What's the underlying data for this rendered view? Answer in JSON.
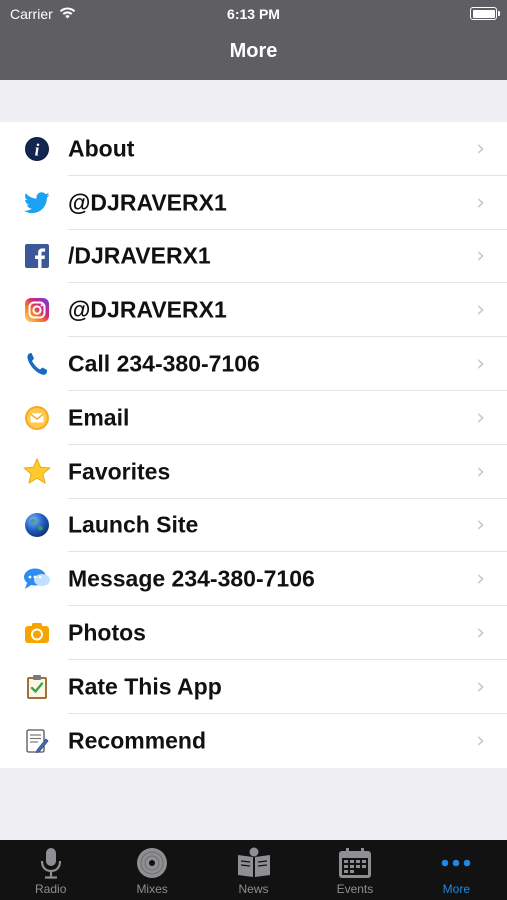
{
  "status": {
    "carrier": "Carrier",
    "time": "6:13 PM"
  },
  "nav": {
    "title": "More"
  },
  "items": [
    {
      "label": "About",
      "icon": "info-icon"
    },
    {
      "label": "@DJRAVERX1",
      "icon": "twitter-icon"
    },
    {
      "label": "/DJRAVERX1",
      "icon": "facebook-icon"
    },
    {
      "label": "@DJRAVERX1",
      "icon": "instagram-icon"
    },
    {
      "label": "Call 234-380-7106",
      "icon": "phone-icon"
    },
    {
      "label": "Email",
      "icon": "email-icon"
    },
    {
      "label": "Favorites",
      "icon": "star-icon"
    },
    {
      "label": "Launch Site",
      "icon": "globe-icon"
    },
    {
      "label": "Message 234-380-7106",
      "icon": "message-icon"
    },
    {
      "label": "Photos",
      "icon": "camera-icon"
    },
    {
      "label": "Rate This App",
      "icon": "clipboard-icon"
    },
    {
      "label": "Recommend",
      "icon": "document-icon"
    }
  ],
  "tabs": [
    {
      "label": "Radio",
      "icon": "microphone-icon",
      "active": false
    },
    {
      "label": "Mixes",
      "icon": "disc-icon",
      "active": false
    },
    {
      "label": "News",
      "icon": "newspaper-icon",
      "active": false
    },
    {
      "label": "Events",
      "icon": "calendar-icon",
      "active": false
    },
    {
      "label": "More",
      "icon": "more-dots-icon",
      "active": true
    }
  ],
  "colors": {
    "header_bg": "#5e5e63",
    "tab_active": "#1e88e5",
    "tab_inactive": "#8e8e93",
    "background": "#efeff4"
  }
}
